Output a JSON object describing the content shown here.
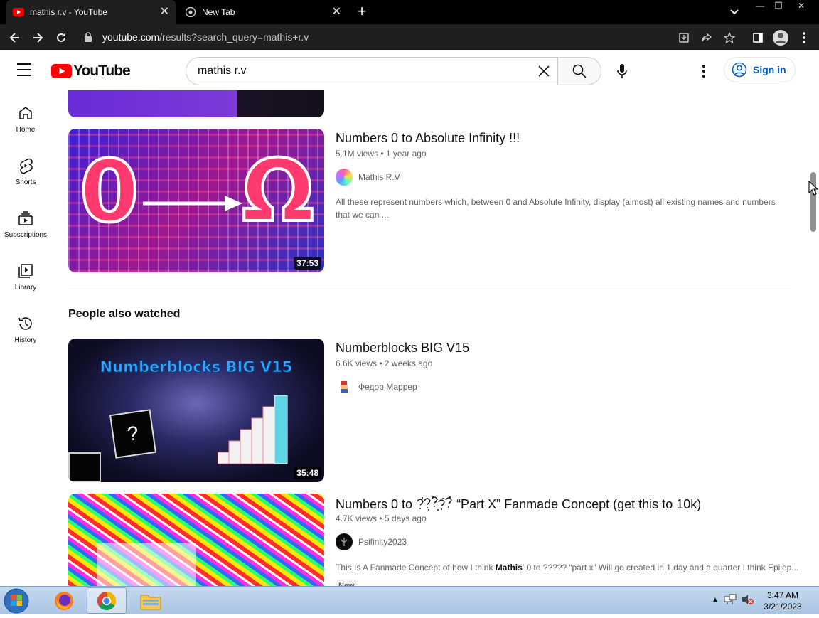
{
  "browser": {
    "tabs": [
      {
        "title": "mathis r.v - YouTube",
        "active": true
      },
      {
        "title": "New Tab",
        "active": false
      }
    ],
    "url_host": "youtube.com",
    "url_path": "/results?search_query=mathis+r.v"
  },
  "youtube": {
    "logo_text": "YouTube",
    "search_query": "mathis r.v",
    "signin_label": "Sign in",
    "sidebar": [
      {
        "label": "Home",
        "icon": "home-icon"
      },
      {
        "label": "Shorts",
        "icon": "shorts-icon"
      },
      {
        "label": "Subscriptions",
        "icon": "subscriptions-icon"
      },
      {
        "label": "Library",
        "icon": "library-icon"
      },
      {
        "label": "History",
        "icon": "history-icon"
      }
    ]
  },
  "results": {
    "video1": {
      "title": "Numbers 0 to Absolute Infinity !!!",
      "views": "5.1M views",
      "age": "1 year ago",
      "channel": "Mathis R.V",
      "description": "All these represent numbers which, between 0 and Absolute Infinity, display (almost) all existing names and numbers that we can ...",
      "duration": "37:53",
      "thumb_text_left": "0",
      "thumb_text_right": "Ω"
    },
    "section_title": "People also watched",
    "video2": {
      "title": "Numberblocks BIG V15",
      "views": "6.6K views",
      "age": "2 weeks ago",
      "channel": "Федор Маррер",
      "duration": "35:48",
      "thumb_text": "Numberblocks BIG V15",
      "thumb_mark": "?"
    },
    "video3": {
      "title_prefix": "Numbers 0 to ",
      "title_suffix": "“Part X” Fanmade Concept (get this to 10k)",
      "views": "4.7K views",
      "age": "5 days ago",
      "channel": "Psifinity2023",
      "description_pre": "This Is A Fanmade Concept of how I think ",
      "description_bold": "Mathis",
      "description_post": "' 0 to ????? “part x” Will go created in 1 day and a quarter I think Epilep...",
      "badge": "New"
    }
  },
  "taskbar": {
    "time": "3:47 AM",
    "date": "3/21/2023"
  },
  "colors": {
    "yt_red": "#ff0000",
    "link_blue": "#065fd4",
    "chrome_dark": "#1f1f1f"
  }
}
